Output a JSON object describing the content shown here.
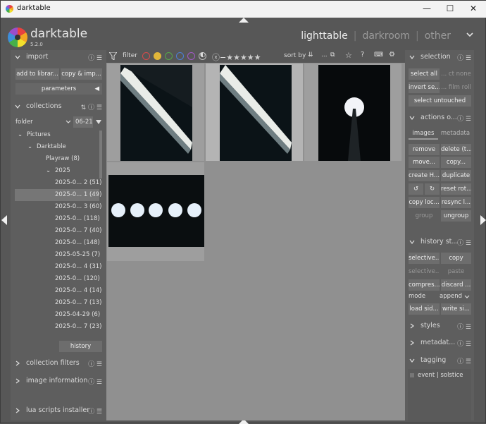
{
  "window": {
    "title": "darktable",
    "minimize": "—",
    "maximize": "☐",
    "close": "✕"
  },
  "header": {
    "app_name": "darktable",
    "version": "5.2.0",
    "views": [
      "lighttable",
      "darkroom",
      "other"
    ],
    "separator": "|"
  },
  "left_panel": {
    "import": {
      "title": "import",
      "add_button": "add to librar...",
      "copy_button": "copy & imp...",
      "parameters_button": "parameters"
    },
    "collections": {
      "title": "collections",
      "property": "folder",
      "filter_value": "06-21",
      "tree": [
        {
          "label": "Pictures",
          "level": 0,
          "expanded": true
        },
        {
          "label": "Darktable",
          "level": 1,
          "expanded": true
        },
        {
          "label": "Playraw (8)",
          "level": 2,
          "expanded": false
        },
        {
          "label": "2025",
          "level": 2,
          "expanded": true
        },
        {
          "label": "2025-0... 2 (51)",
          "level": 3
        },
        {
          "label": "2025-0... 1 (49)",
          "level": 3,
          "selected": true
        },
        {
          "label": "2025-0... 3 (60)",
          "level": 3
        },
        {
          "label": "2025-0...  (118)",
          "level": 3
        },
        {
          "label": "2025-0... 7 (40)",
          "level": 3
        },
        {
          "label": "2025-0...  (148)",
          "level": 3
        },
        {
          "label": "2025-05-25 (7)",
          "level": 3
        },
        {
          "label": "2025-0... 4 (31)",
          "level": 3
        },
        {
          "label": "2025-0...  (120)",
          "level": 3
        },
        {
          "label": "2025-0... 4 (14)",
          "level": 3
        },
        {
          "label": "2025-0... 7 (13)",
          "level": 3
        },
        {
          "label": "2025-04-29 (6)",
          "level": 3
        },
        {
          "label": "2025-0... 7 (23)",
          "level": 3
        }
      ],
      "history_button": "history"
    },
    "collection_filters": {
      "title": "collection filters"
    },
    "image_information": {
      "title": "image information"
    },
    "lua_scripts": {
      "title": "lua scripts installer"
    }
  },
  "toolbar": {
    "filter_label": "filter",
    "color_labels": [
      "#d94b4b",
      "#e0b63a",
      "#55a84a",
      "#4b7fd9",
      "#a458c9"
    ],
    "stars": "★★★★★",
    "sort_label": "sort by",
    "more": "..."
  },
  "right_panel": {
    "selection": {
      "title": "selection",
      "select_all": "select all",
      "select_none": "... ct none",
      "invert": "invert se...",
      "film_roll": "... film roll",
      "untouched": "select untouched"
    },
    "actions": {
      "title": "actions o...",
      "tabs": [
        "images",
        "metadata"
      ],
      "buttons": [
        "remove",
        "delete (t...",
        "move...",
        "copy...",
        "create H...",
        "duplicate",
        "",
        "",
        "reset rot...",
        "copy loc...",
        "resync l...",
        "group",
        "ungroup"
      ]
    },
    "history_stack": {
      "title": "history st...",
      "selective_copy": "selective...",
      "copy": "copy",
      "selective_paste": "selective...",
      "paste": "paste",
      "compress": "compres...",
      "discard": "discard ...",
      "mode_label": "mode",
      "mode_value": "append",
      "load_sidecar": "load sid...",
      "write_sidecar": "write si..."
    },
    "styles": {
      "title": "styles"
    },
    "metadata": {
      "title": "metadat..."
    },
    "tagging": {
      "title": "tagging",
      "tag": "event | solstice"
    }
  }
}
